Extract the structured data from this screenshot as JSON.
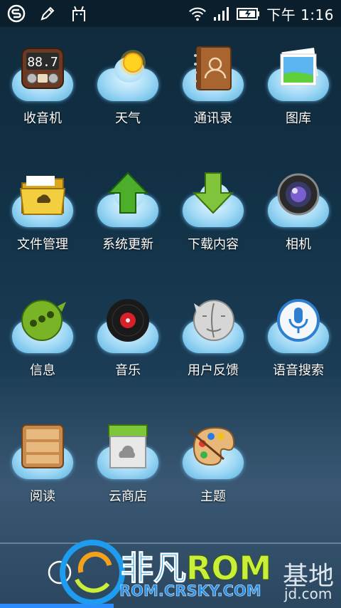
{
  "status_bar": {
    "icons_left": [
      "s-logo-icon",
      "pen-icon",
      "android-icon"
    ],
    "icons_right": [
      "wifi-icon",
      "signal-icon",
      "battery-icon"
    ],
    "time": "下午 1:16"
  },
  "apps": [
    {
      "label": "收音机",
      "icon": "radio-icon"
    },
    {
      "label": "天气",
      "icon": "weather-icon"
    },
    {
      "label": "通讯录",
      "icon": "contacts-icon"
    },
    {
      "label": "图库",
      "icon": "gallery-icon"
    },
    {
      "label": "文件管理",
      "icon": "folder-icon"
    },
    {
      "label": "系统更新",
      "icon": "update-arrow-icon"
    },
    {
      "label": "下载内容",
      "icon": "download-arrow-icon"
    },
    {
      "label": "相机",
      "icon": "camera-icon"
    },
    {
      "label": "信息",
      "icon": "messages-icon"
    },
    {
      "label": "音乐",
      "icon": "music-icon"
    },
    {
      "label": "用户反馈",
      "icon": "feedback-icon"
    },
    {
      "label": "语音搜索",
      "icon": "voice-search-icon"
    },
    {
      "label": "阅读",
      "icon": "bookshelf-icon"
    },
    {
      "label": "云商店",
      "icon": "store-icon"
    },
    {
      "label": "主题",
      "icon": "palette-icon"
    }
  ],
  "radio_display": "88.7",
  "watermark": {
    "title_a": "非凡",
    "title_b": "ROM",
    "url": "ROM.CRSKY.COM",
    "right_text": "基地",
    "right_sub": "jd.com"
  },
  "colors": {
    "accent_blue": "#2b8cff",
    "cloud_blue": "#9ed8f5"
  }
}
